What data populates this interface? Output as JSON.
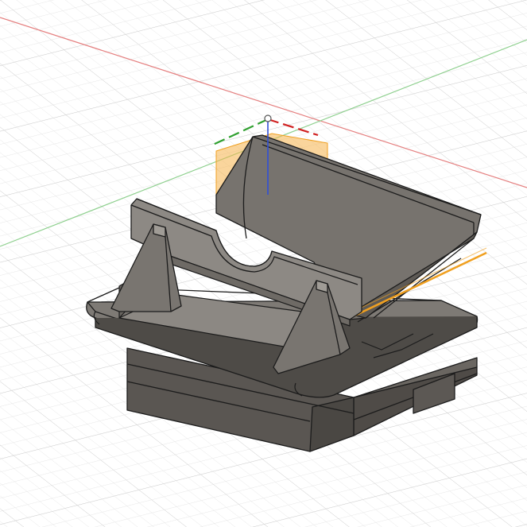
{
  "app": "CAD 3D viewport",
  "colors": {
    "background": "#ffffff",
    "grid_minor": "#ececec",
    "grid_major": "#d4d4d4",
    "axis_x": "#e06060",
    "axis_y": "#6cc46c",
    "axis_z": "#3050d8",
    "body_fill": "#6f6b66",
    "body_dark": "#4e4b47",
    "body_light": "#8a8681",
    "edge": "#1c1c1c",
    "selection": "#f0a020"
  },
  "view": {
    "mode": "perspective",
    "grid": true,
    "origin_marker": "origin-icon"
  },
  "model": {
    "object": "phone-stand-body",
    "selected_plane": "construction-plane",
    "highlight_color_name": "orange"
  }
}
